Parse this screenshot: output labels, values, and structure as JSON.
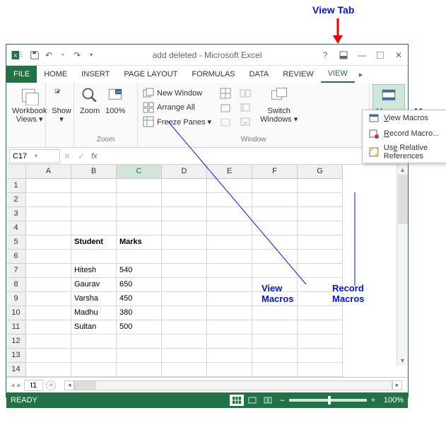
{
  "annotations": {
    "view_tab": "View Tab",
    "macros_tab": "Macros\nTab",
    "view_macros": "View\nMacros",
    "record_macros": "Record\nMacros"
  },
  "titlebar": {
    "title": "add deleted - Microsoft Excel"
  },
  "tabs": {
    "file": "FILE",
    "home": "HOME",
    "insert": "INSERT",
    "page_layout": "PAGE LAYOUT",
    "formulas": "FORMULAS",
    "data": "DATA",
    "review": "REVIEW",
    "view": "VIEW"
  },
  "ribbon": {
    "workbook_views": "Workbook\nViews ▾",
    "show": "Show\n▾",
    "zoom_group": "Zoom",
    "zoom": "Zoom",
    "hundred": "100%",
    "new_window": "New Window",
    "arrange_all": "Arrange All",
    "freeze_panes": "Freeze Panes ▾",
    "switch_windows": "Switch\nWindows ▾",
    "macros": "Macros\n▾",
    "window_group": "Window"
  },
  "macros_menu": {
    "view": "View Macros",
    "record": "Record Macro...",
    "relative": "Use Relative References"
  },
  "name_box": "C17",
  "fx": "fx",
  "columns": [
    "A",
    "B",
    "C",
    "D",
    "E",
    "F",
    "G"
  ],
  "rows": [
    1,
    2,
    3,
    4,
    5,
    6,
    7,
    8,
    9,
    10,
    11,
    12,
    13,
    14
  ],
  "cells": {
    "b5": "Student",
    "c5": "Marks",
    "b7": "Hitesh",
    "c7": "540",
    "b8": "Gaurav",
    "c8": "650",
    "b9": "Varsha",
    "c9": "450",
    "b10": "Madhu",
    "c10": "380",
    "b11": "Sultan",
    "c11": "500"
  },
  "sheet_tab": "t1",
  "status": "READY",
  "zoom": "100%",
  "chart_data": {
    "type": "table",
    "columns": [
      "Student",
      "Marks"
    ],
    "rows": [
      [
        "Hitesh",
        540
      ],
      [
        "Gaurav",
        650
      ],
      [
        "Varsha",
        450
      ],
      [
        "Madhu",
        380
      ],
      [
        "Sultan",
        500
      ]
    ]
  }
}
